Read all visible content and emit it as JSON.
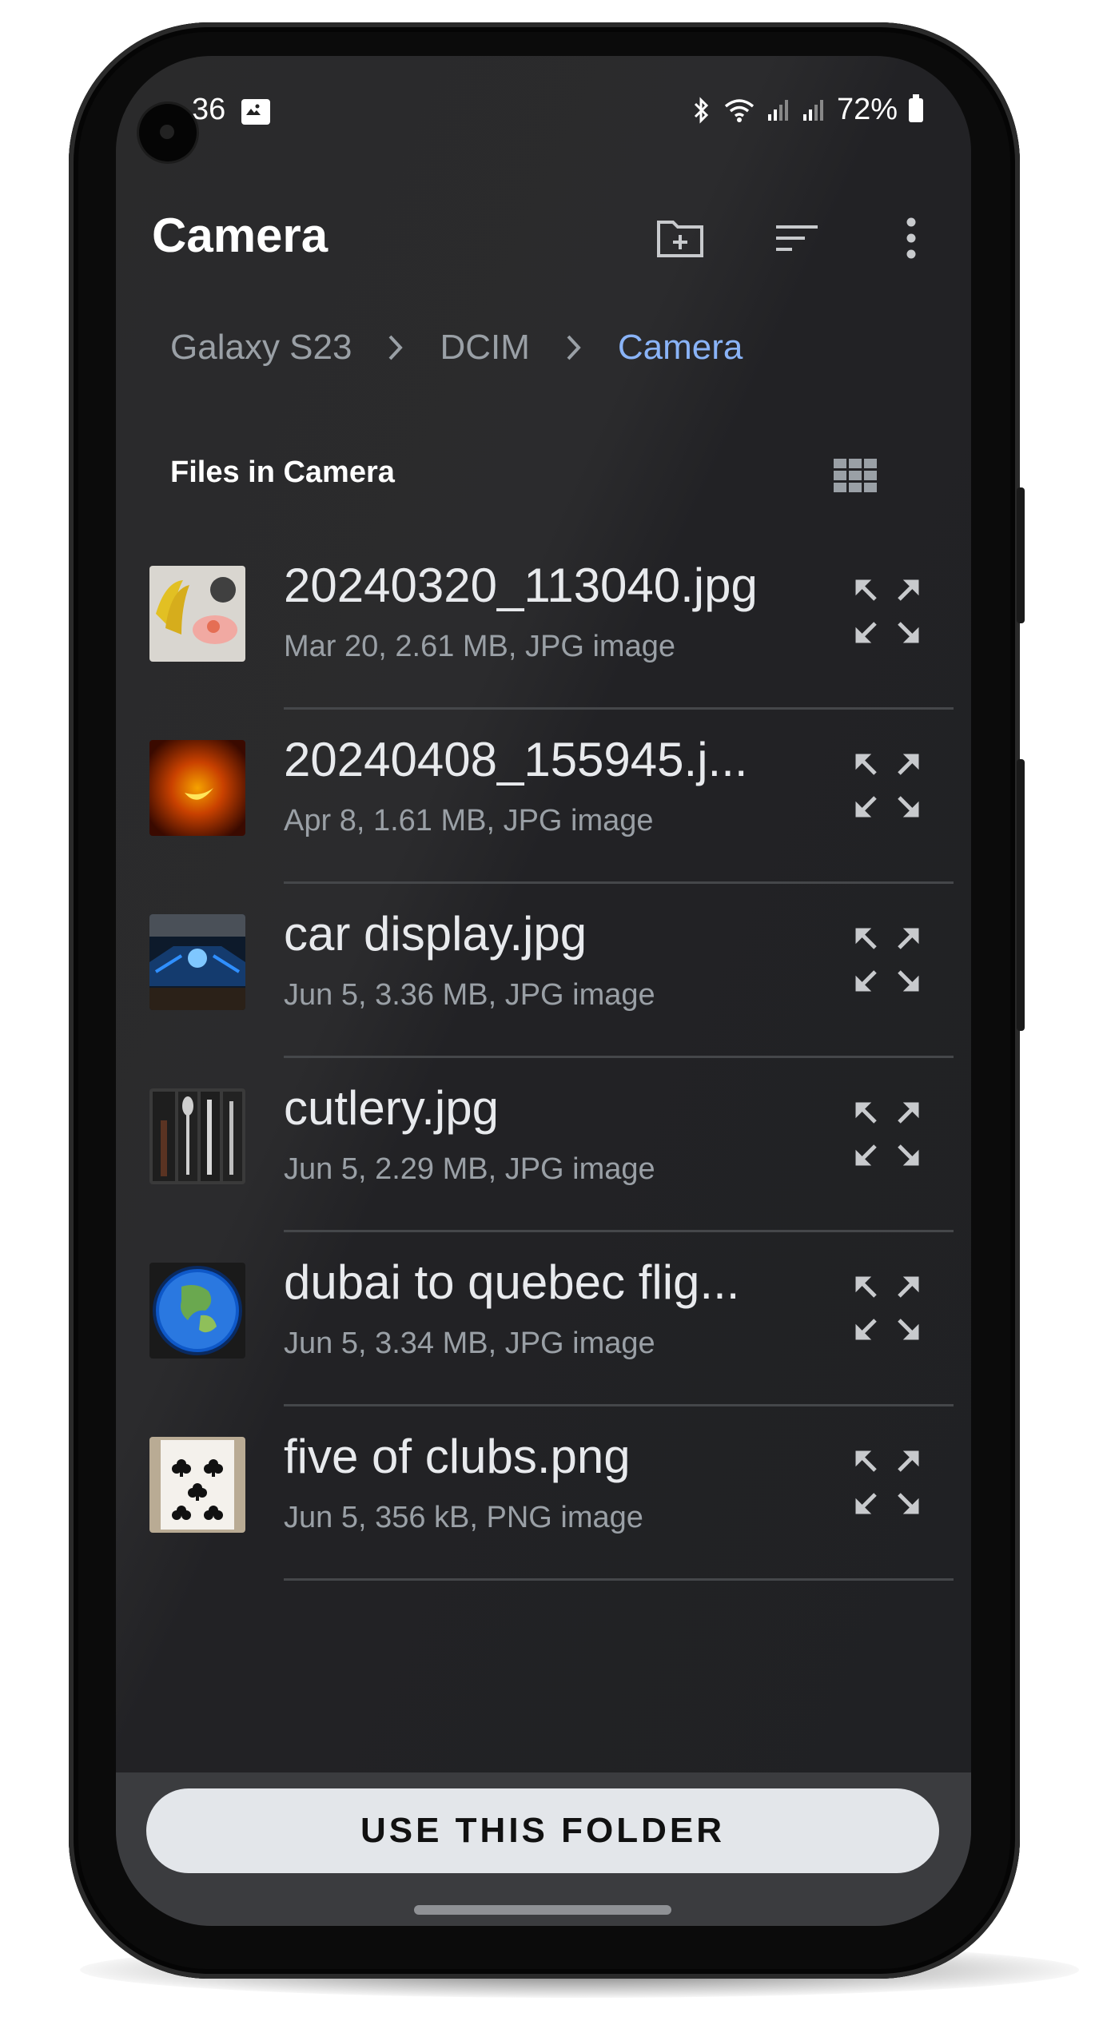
{
  "status_bar": {
    "time": "36",
    "battery": "72%"
  },
  "app_bar": {
    "title": "Camera"
  },
  "breadcrumb": {
    "items": [
      "Galaxy S23",
      "DCIM",
      "Camera"
    ]
  },
  "section": {
    "label": "Files in Camera"
  },
  "files": [
    {
      "name": "20240320_113040.jpg",
      "meta": "Mar 20, 2.61 MB, JPG image"
    },
    {
      "name": "20240408_155945.j...",
      "meta": "Apr 8, 1.61 MB, JPG image"
    },
    {
      "name": "car display.jpg",
      "meta": "Jun 5, 3.36 MB, JPG image"
    },
    {
      "name": "cutlery.jpg",
      "meta": "Jun 5, 2.29 MB, JPG image"
    },
    {
      "name": "dubai to quebec flig...",
      "meta": "Jun 5, 3.34 MB, JPG image"
    },
    {
      "name": "five of clubs.png",
      "meta": "Jun 5, 356 kB, PNG image"
    }
  ],
  "bottom": {
    "button_label": "USE THIS FOLDER"
  },
  "colors": {
    "background": "#202124",
    "accent": "#8ab4f8",
    "button": "#e3e6ea"
  },
  "icons": [
    "image-icon",
    "bluetooth-icon",
    "wifi-icon",
    "signal-icon",
    "battery-icon",
    "new-folder-icon",
    "sort-icon",
    "more-vert-icon",
    "chevron-right-icon",
    "grid-view-icon",
    "expand-icon"
  ]
}
